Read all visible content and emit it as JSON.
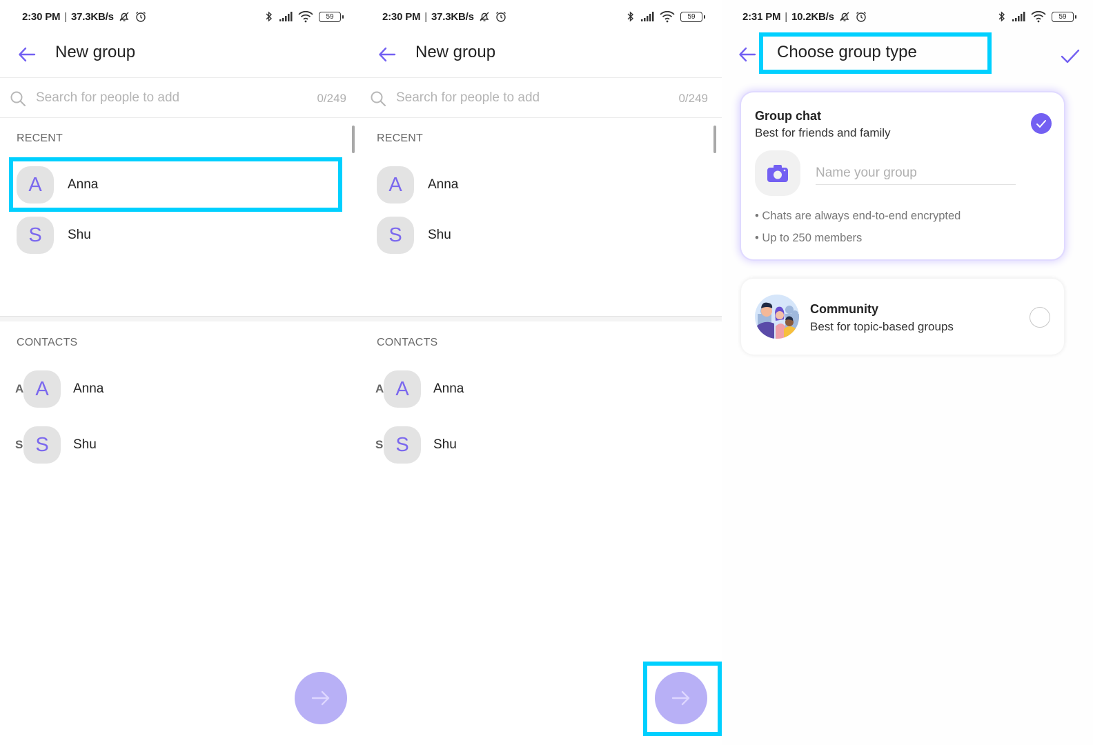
{
  "colors": {
    "accent": "#7360f2",
    "fab": "#b8b0f6",
    "highlight": "#00d0ff",
    "avatar_bg": "#e3e3e3"
  },
  "screens": [
    {
      "status": {
        "time": "2:30 PM",
        "speed": "37.3KB/s",
        "battery": "59"
      },
      "header": {
        "title": "New group"
      },
      "search": {
        "placeholder": "Search for people to add",
        "counter": "0/249"
      },
      "recent": {
        "label": "RECENT",
        "items": [
          {
            "initial": "A",
            "name": "Anna"
          },
          {
            "initial": "S",
            "name": "Shu"
          }
        ]
      },
      "contacts": {
        "label": "CONTACTS",
        "items": [
          {
            "index": "A",
            "initial": "A",
            "name": "Anna"
          },
          {
            "index": "S",
            "initial": "S",
            "name": "Shu"
          }
        ]
      },
      "fab": {
        "icon": "arrow-right-icon"
      },
      "highlighted": "recent-anna"
    },
    {
      "status": {
        "time": "2:30 PM",
        "speed": "37.3KB/s",
        "battery": "59"
      },
      "header": {
        "title": "New group"
      },
      "search": {
        "placeholder": "Search for people to add",
        "counter": "0/249"
      },
      "recent": {
        "label": "RECENT",
        "items": [
          {
            "initial": "A",
            "name": "Anna"
          },
          {
            "initial": "S",
            "name": "Shu"
          }
        ]
      },
      "contacts": {
        "label": "CONTACTS",
        "items": [
          {
            "index": "A",
            "initial": "A",
            "name": "Anna"
          },
          {
            "index": "S",
            "initial": "S",
            "name": "Shu"
          }
        ]
      },
      "fab": {
        "icon": "arrow-right-icon"
      },
      "highlighted": "next-button"
    },
    {
      "status": {
        "time": "2:31 PM",
        "speed": "10.2KB/s",
        "battery": "59"
      },
      "header": {
        "title": "Choose group type"
      },
      "options": [
        {
          "title": "Group chat",
          "subtitle": "Best for friends and family",
          "selected": true,
          "name_placeholder": "Name your group",
          "bullets": [
            "• Chats are always end-to-end encrypted",
            "• Up to 250 members"
          ]
        },
        {
          "title": "Community",
          "subtitle": "Best for topic-based groups",
          "selected": false
        }
      ],
      "highlighted": "header-title"
    }
  ]
}
